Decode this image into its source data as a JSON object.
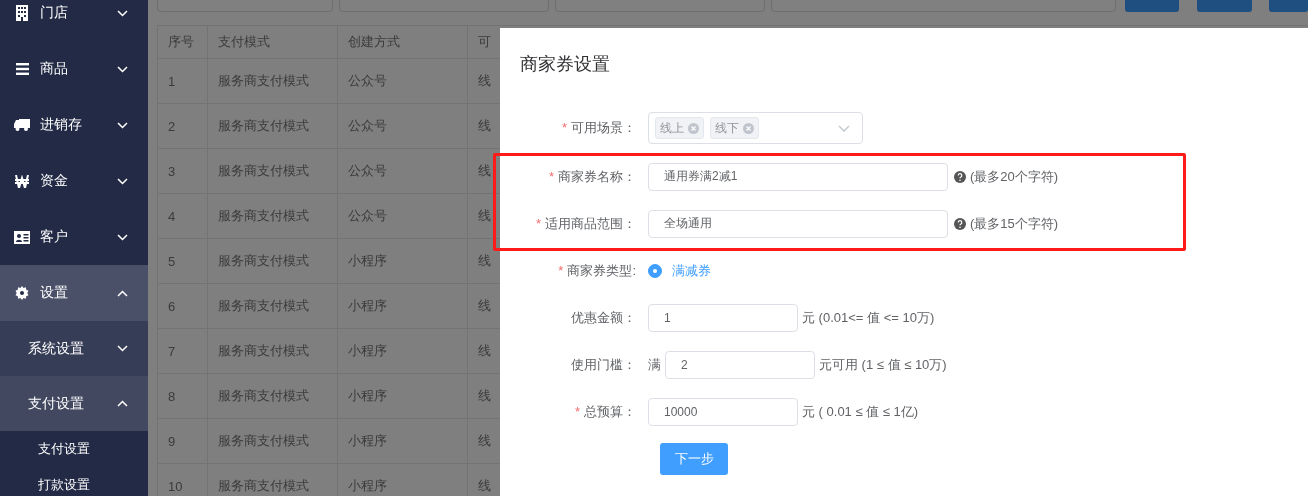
{
  "sidebar": {
    "items": [
      {
        "label": "门店",
        "expanded": false
      },
      {
        "label": "商品",
        "expanded": false
      },
      {
        "label": "进销存",
        "expanded": false
      },
      {
        "label": "资金",
        "expanded": false
      },
      {
        "label": "客户",
        "expanded": false
      },
      {
        "label": "设置",
        "expanded": true,
        "children": [
          {
            "label": "系统设置",
            "expanded": false
          },
          {
            "label": "支付设置",
            "expanded": true,
            "children": [
              {
                "label": "支付设置"
              },
              {
                "label": "打款设置"
              }
            ]
          }
        ]
      }
    ]
  },
  "table": {
    "columns": [
      "序号",
      "支付模式",
      "创建方式",
      "可"
    ],
    "rows": [
      [
        "1",
        "服务商支付模式",
        "公众号",
        "线"
      ],
      [
        "2",
        "服务商支付模式",
        "公众号",
        "线"
      ],
      [
        "3",
        "服务商支付模式",
        "公众号",
        "线"
      ],
      [
        "4",
        "服务商支付模式",
        "公众号",
        "线"
      ],
      [
        "5",
        "服务商支付模式",
        "小程序",
        "线"
      ],
      [
        "6",
        "服务商支付模式",
        "小程序",
        "线"
      ],
      [
        "7",
        "服务商支付模式",
        "小程序",
        "线"
      ],
      [
        "8",
        "服务商支付模式",
        "小程序",
        "线"
      ],
      [
        "9",
        "服务商支付模式",
        "小程序",
        "线"
      ],
      [
        "10",
        "服务商支付模式",
        "小程序",
        "线"
      ]
    ]
  },
  "dialog": {
    "title": "商家券设置",
    "fields": [
      {
        "kind": "tags",
        "required_mark": "*",
        "label": "可用场景：",
        "tags": [
          "线上",
          "线下"
        ]
      },
      {
        "kind": "input",
        "required_mark": "*",
        "label": "商家券名称：",
        "value": "通用券满2减1",
        "hint": "(最多20个字符)"
      },
      {
        "kind": "input",
        "required_mark": "*",
        "label": "适用商品范围：",
        "value": "全场通用",
        "hint": "(最多15个字符)"
      },
      {
        "kind": "radio",
        "required_mark": "*",
        "label": "商家券类型:",
        "options": [
          {
            "label": "满减券",
            "selected": true
          }
        ]
      },
      {
        "kind": "amount",
        "label": "优惠金额：",
        "value": "1",
        "suffix": "元 (0.01<= 值 <= 10万)"
      },
      {
        "kind": "amount",
        "label": "使用门槛：",
        "prefix": "满",
        "value": "2",
        "suffix": "元可用 (1 ≤ 值 ≤ 10万)"
      },
      {
        "kind": "amount",
        "required_mark": "*",
        "label": "总预算：",
        "value": "10000",
        "suffix": "元 ( 0.01 ≤ 值 ≤ 1亿)"
      }
    ],
    "submit": "下一步"
  }
}
